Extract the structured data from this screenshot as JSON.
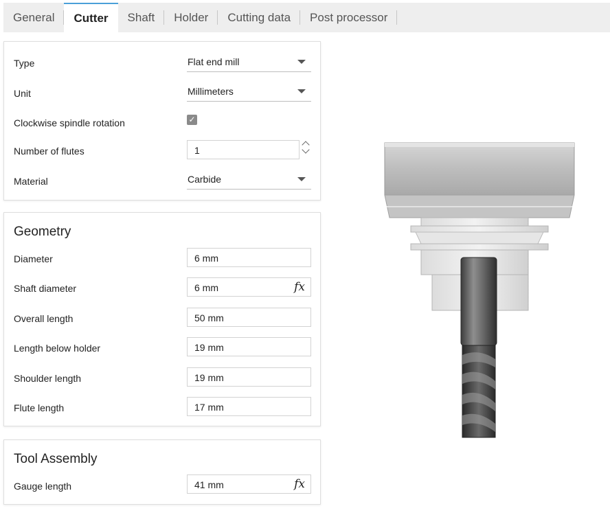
{
  "tabs": [
    {
      "label": "General"
    },
    {
      "label": "Cutter",
      "active": true
    },
    {
      "label": "Shaft"
    },
    {
      "label": "Holder"
    },
    {
      "label": "Cutting data"
    },
    {
      "label": "Post processor"
    }
  ],
  "cutter": {
    "type": {
      "label": "Type",
      "value": "Flat end mill"
    },
    "unit": {
      "label": "Unit",
      "value": "Millimeters"
    },
    "clockwise": {
      "label": "Clockwise spindle rotation",
      "checked": true
    },
    "flutes": {
      "label": "Number of flutes",
      "value": "1"
    },
    "material": {
      "label": "Material",
      "value": "Carbide"
    }
  },
  "geometry": {
    "title": "Geometry",
    "diameter": {
      "label": "Diameter",
      "value": "6 mm"
    },
    "shaft_diameter": {
      "label": "Shaft diameter",
      "value": "6 mm",
      "fx": "fx"
    },
    "overall_length": {
      "label": "Overall length",
      "value": "50 mm"
    },
    "length_below_holder": {
      "label": "Length below holder",
      "value": "19 mm"
    },
    "shoulder_length": {
      "label": "Shoulder length",
      "value": "19 mm"
    },
    "flute_length": {
      "label": "Flute length",
      "value": "17 mm"
    }
  },
  "assembly": {
    "title": "Tool Assembly",
    "gauge_length": {
      "label": "Gauge length",
      "value": "41 mm",
      "fx": "fx"
    }
  },
  "colors": {
    "accent": "#4a9fd8",
    "tabbar": "#eeeeee"
  }
}
